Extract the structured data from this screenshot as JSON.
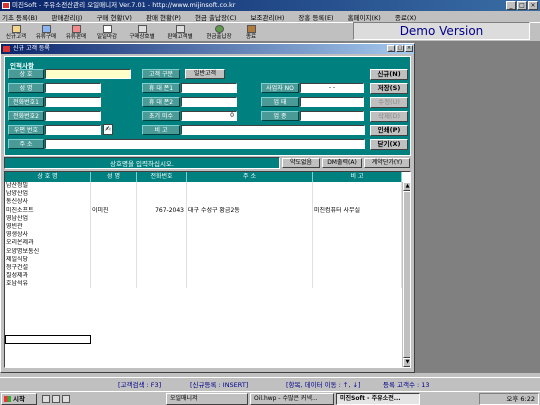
{
  "window": {
    "title": "미진Soft - 주유소전산관리 오일매니저 Ver.7.01 - http://www.mijinsoft.co.kr"
  },
  "menu": [
    "기초 등록(B)",
    "판매관리(J)",
    "구매 현황(V)",
    "판매 현황(P)",
    "현금 출납장(C)",
    "보조관리(H)",
    "장홍 등록(E)",
    "홈페이지(K)",
    "종료(X)"
  ],
  "toolbar": [
    "신규고객",
    "유류구매",
    "유류판매",
    "일일마감",
    "구매상호별",
    "판매고객별",
    "현금출납장",
    "종료"
  ],
  "demo_label": "Demo Version",
  "child_window": {
    "title": "신규 고객 등록"
  },
  "form": {
    "section_title": "인적사항",
    "labels": {
      "name": "상 호",
      "owner": "성 명",
      "phone1": "전화번호1",
      "phone2": "전화번호2",
      "zipcode": "우편 번호",
      "address": "주 소",
      "cust_type": "고객 구분",
      "mobile1": "휴 대 폰1",
      "mobile2": "휴 대 폰2",
      "init_unpaid": "초기 미수",
      "memo": "비 고",
      "biz_no": "사업자 NO",
      "biz_type": "업 태",
      "biz_item": "업 종"
    },
    "values": {
      "cust_type": "일반고객",
      "init_unpaid": "0",
      "biz_no": "-   -"
    },
    "side_buttons": [
      "신규(N)",
      "저장(S)",
      "수정(U)",
      "삭제(D)",
      "인쇄(P)",
      "닫기(X)"
    ],
    "message": "상호명을 입력하십시오.",
    "action_buttons": [
      "약도없음",
      "DM출력(A)",
      "계약단가(Y)"
    ]
  },
  "grid": {
    "columns": [
      "상 호 명",
      "성 명",
      "전화번호",
      "주 소",
      "비 고"
    ],
    "rows": [
      [
        "남산정밀",
        "",
        "",
        "",
        ""
      ],
      [
        "남양산업",
        "",
        "",
        "",
        ""
      ],
      [
        "동신상사",
        "",
        "",
        "",
        ""
      ],
      [
        "미진소프트",
        "이미진",
        "767-2043",
        "대구 수성구 황금2동",
        "미진컴퓨터 사무실"
      ],
      [
        "영남산업",
        "",
        "",
        "",
        ""
      ],
      [
        "영빈관",
        "",
        "",
        "",
        ""
      ],
      [
        "영생상사",
        "",
        "",
        "",
        ""
      ],
      [
        "오리온제과",
        "",
        "",
        "",
        ""
      ],
      [
        "오양명보통신",
        "",
        "",
        "",
        ""
      ],
      [
        "제일식당",
        "",
        "",
        "",
        ""
      ],
      [
        "청구건설",
        "",
        "",
        "",
        ""
      ],
      [
        "칠성제과",
        "",
        "",
        "",
        ""
      ],
      [
        "호남석유",
        "",
        "",
        "",
        ""
      ]
    ]
  },
  "status": [
    "[고객검색 : F3]",
    "[신규등록 : INSERT]",
    "[항목, 데이터 이동 : ↑, ↓]",
    "등록 고객수 : 13"
  ],
  "taskbar": {
    "start": "시작",
    "tasks": [
      "오일매니저",
      "Oil.hwp - 수많은 커넥...",
      "미진Soft - 주유소전..."
    ],
    "clock": "오후 6:22"
  },
  "colors": {
    "panel": "#00807f",
    "title": "#0a246a",
    "demo_text": "#00008b"
  }
}
